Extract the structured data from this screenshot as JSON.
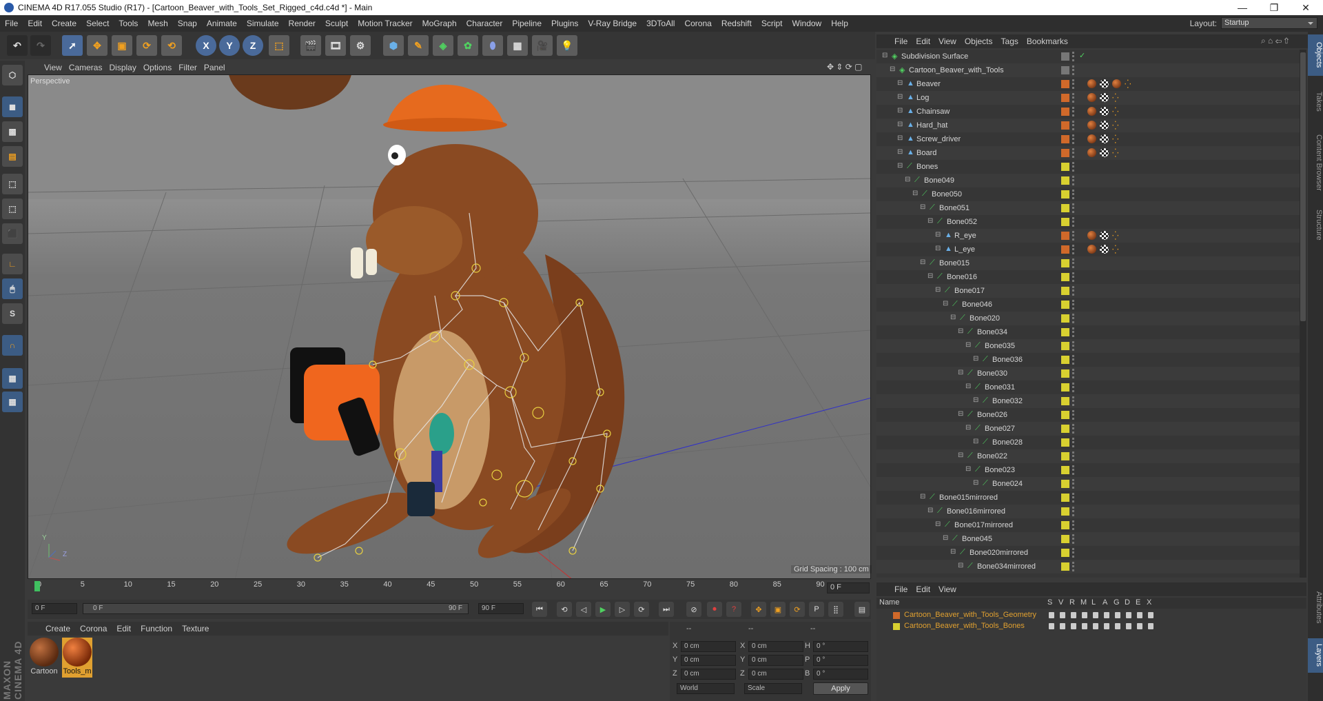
{
  "window": {
    "title": "CINEMA 4D R17.055 Studio (R17) - [Cartoon_Beaver_with_Tools_Set_Rigged_c4d.c4d *] - Main",
    "minimize": "—",
    "maximize": "❐",
    "close": "✕"
  },
  "menubar": {
    "items": [
      "File",
      "Edit",
      "Create",
      "Select",
      "Tools",
      "Mesh",
      "Snap",
      "Animate",
      "Simulate",
      "Render",
      "Sculpt",
      "Motion Tracker",
      "MoGraph",
      "Character",
      "Pipeline",
      "Plugins",
      "V-Ray Bridge",
      "3DToAll",
      "Corona",
      "Redshift",
      "Script",
      "Window",
      "Help"
    ],
    "layout_label": "Layout:",
    "layout_value": "Startup"
  },
  "toolbar": {
    "x_label": "X",
    "y_label": "Y",
    "z_label": "Z"
  },
  "viewport": {
    "menu": [
      "View",
      "Cameras",
      "Display",
      "Options",
      "Filter",
      "Panel"
    ],
    "camera_label": "Perspective",
    "grid_spacing": "Grid Spacing : 100 cm",
    "axis_labels": {
      "y": "Y",
      "z": "Z"
    }
  },
  "timeline": {
    "ticks": [
      "0",
      "5",
      "10",
      "15",
      "20",
      "25",
      "30",
      "35",
      "40",
      "45",
      "50",
      "55",
      "60",
      "65",
      "70",
      "75",
      "80",
      "85",
      "90"
    ],
    "current_frame": "0 F",
    "start_field": "0 F",
    "range_start": "0 F",
    "range_end": "90 F",
    "end_field": "90 F",
    "playhead_frame": 0
  },
  "materials": {
    "menu": [
      "Create",
      "Corona",
      "Edit",
      "Function",
      "Texture"
    ],
    "items": [
      {
        "name": "Cartoon"
      },
      {
        "name": "Tools_m"
      }
    ]
  },
  "coordinates": {
    "headers": [
      "--",
      "--",
      "--"
    ],
    "rows": [
      {
        "a": "X",
        "av": "0 cm",
        "b": "X",
        "bv": "0 cm",
        "c": "H",
        "cv": "0 °"
      },
      {
        "a": "Y",
        "av": "0 cm",
        "b": "Y",
        "bv": "0 cm",
        "c": "P",
        "cv": "0 °"
      },
      {
        "a": "Z",
        "av": "0 cm",
        "b": "Z",
        "bv": "0 cm",
        "c": "B",
        "cv": "0 °"
      }
    ],
    "space": "World",
    "mode": "Scale",
    "apply": "Apply"
  },
  "objects": {
    "menu": [
      "File",
      "Edit",
      "View",
      "Objects",
      "Tags",
      "Bookmarks"
    ],
    "rows": [
      {
        "name": "Subdivision Surface",
        "indent": 0,
        "color": "#777",
        "icon": "subdivision",
        "tags": 0,
        "check": true
      },
      {
        "name": "Cartoon_Beaver_with_Tools",
        "indent": 1,
        "color": "#777",
        "icon": "null",
        "tags": 0
      },
      {
        "name": "Beaver",
        "indent": 2,
        "color": "#d0692a",
        "icon": "poly",
        "tags": 4
      },
      {
        "name": "Log",
        "indent": 2,
        "color": "#d0692a",
        "icon": "poly",
        "tags": 3
      },
      {
        "name": "Chainsaw",
        "indent": 2,
        "color": "#d0692a",
        "icon": "poly",
        "tags": 3
      },
      {
        "name": "Hard_hat",
        "indent": 2,
        "color": "#d0692a",
        "icon": "poly",
        "tags": 3
      },
      {
        "name": "Screw_driver",
        "indent": 2,
        "color": "#d0692a",
        "icon": "poly",
        "tags": 3
      },
      {
        "name": "Board",
        "indent": 2,
        "color": "#d0692a",
        "icon": "poly",
        "tags": 3
      },
      {
        "name": "Bones",
        "indent": 2,
        "color": "#d8d030",
        "icon": "bone",
        "tags": 0
      },
      {
        "name": "Bone049",
        "indent": 3,
        "color": "#d8d030",
        "icon": "bone",
        "tags": 0
      },
      {
        "name": "Bone050",
        "indent": 4,
        "color": "#d8d030",
        "icon": "bone",
        "tags": 0
      },
      {
        "name": "Bone051",
        "indent": 5,
        "color": "#d8d030",
        "icon": "bone",
        "tags": 0
      },
      {
        "name": "Bone052",
        "indent": 6,
        "color": "#d8d030",
        "icon": "bone",
        "tags": 0
      },
      {
        "name": "R_eye",
        "indent": 7,
        "color": "#d0692a",
        "icon": "poly",
        "tags": 3
      },
      {
        "name": "L_eye",
        "indent": 7,
        "color": "#d0692a",
        "icon": "poly",
        "tags": 3
      },
      {
        "name": "Bone015",
        "indent": 5,
        "color": "#d8d030",
        "icon": "bone",
        "tags": 0
      },
      {
        "name": "Bone016",
        "indent": 6,
        "color": "#d8d030",
        "icon": "bone",
        "tags": 0
      },
      {
        "name": "Bone017",
        "indent": 7,
        "color": "#d8d030",
        "icon": "bone",
        "tags": 0
      },
      {
        "name": "Bone046",
        "indent": 8,
        "color": "#d8d030",
        "icon": "bone",
        "tags": 0
      },
      {
        "name": "Bone020",
        "indent": 9,
        "color": "#d8d030",
        "icon": "bone",
        "tags": 0
      },
      {
        "name": "Bone034",
        "indent": 10,
        "color": "#d8d030",
        "icon": "bone",
        "tags": 0
      },
      {
        "name": "Bone035",
        "indent": 11,
        "color": "#d8d030",
        "icon": "bone",
        "tags": 0
      },
      {
        "name": "Bone036",
        "indent": 12,
        "color": "#d8d030",
        "icon": "bone",
        "tags": 0
      },
      {
        "name": "Bone030",
        "indent": 10,
        "color": "#d8d030",
        "icon": "bone",
        "tags": 0
      },
      {
        "name": "Bone031",
        "indent": 11,
        "color": "#d8d030",
        "icon": "bone",
        "tags": 0
      },
      {
        "name": "Bone032",
        "indent": 12,
        "color": "#d8d030",
        "icon": "bone",
        "tags": 0
      },
      {
        "name": "Bone026",
        "indent": 10,
        "color": "#d8d030",
        "icon": "bone",
        "tags": 0
      },
      {
        "name": "Bone027",
        "indent": 11,
        "color": "#d8d030",
        "icon": "bone",
        "tags": 0
      },
      {
        "name": "Bone028",
        "indent": 12,
        "color": "#d8d030",
        "icon": "bone",
        "tags": 0
      },
      {
        "name": "Bone022",
        "indent": 10,
        "color": "#d8d030",
        "icon": "bone",
        "tags": 0
      },
      {
        "name": "Bone023",
        "indent": 11,
        "color": "#d8d030",
        "icon": "bone",
        "tags": 0
      },
      {
        "name": "Bone024",
        "indent": 12,
        "color": "#d8d030",
        "icon": "bone",
        "tags": 0
      },
      {
        "name": "Bone015mirrored",
        "indent": 5,
        "color": "#d8d030",
        "icon": "bone",
        "tags": 0
      },
      {
        "name": "Bone016mirrored",
        "indent": 6,
        "color": "#d8d030",
        "icon": "bone",
        "tags": 0
      },
      {
        "name": "Bone017mirrored",
        "indent": 7,
        "color": "#d8d030",
        "icon": "bone",
        "tags": 0
      },
      {
        "name": "Bone045",
        "indent": 8,
        "color": "#d8d030",
        "icon": "bone",
        "tags": 0
      },
      {
        "name": "Bone020mirrored",
        "indent": 9,
        "color": "#d8d030",
        "icon": "bone",
        "tags": 0
      },
      {
        "name": "Bone034mirrored",
        "indent": 10,
        "color": "#d8d030",
        "icon": "bone",
        "tags": 0
      }
    ]
  },
  "right_tabs": [
    "Objects",
    "Takes",
    "Content Browser",
    "Structure"
  ],
  "right_tabs_lower": [
    "Attributes",
    "Layers"
  ],
  "layers": {
    "menu": [
      "File",
      "Edit",
      "View"
    ],
    "headers": [
      "Name",
      "S",
      "V",
      "R",
      "M",
      "L",
      "A",
      "G",
      "D",
      "E",
      "X"
    ],
    "rows": [
      {
        "name": "Cartoon_Beaver_with_Tools_Geometry",
        "color": "#d0692a"
      },
      {
        "name": "Cartoon_Beaver_with_Tools_Bones",
        "color": "#d8d030"
      }
    ]
  }
}
